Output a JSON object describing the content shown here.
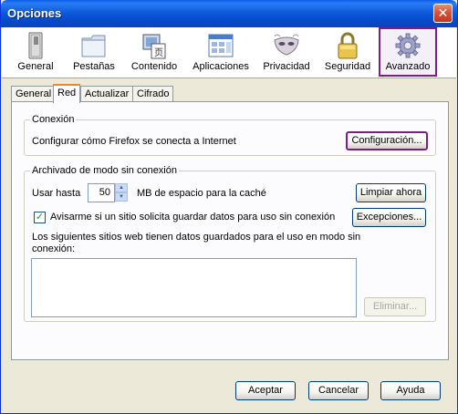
{
  "window": {
    "title": "Opciones",
    "close_glyph": "✕"
  },
  "toolbar": {
    "items": [
      {
        "label": "General",
        "icon": "general-icon"
      },
      {
        "label": "Pestañas",
        "icon": "tabs-icon"
      },
      {
        "label": "Contenido",
        "icon": "content-icon"
      },
      {
        "label": "Aplicaciones",
        "icon": "applications-icon"
      },
      {
        "label": "Privacidad",
        "icon": "privacy-mask-icon"
      },
      {
        "label": "Seguridad",
        "icon": "padlock-icon"
      },
      {
        "label": "Avanzado",
        "icon": "gear-icon",
        "selected": true
      }
    ]
  },
  "tabs": [
    {
      "label": "General"
    },
    {
      "label": "Red",
      "active": true
    },
    {
      "label": "Actualizar"
    },
    {
      "label": "Cifrado"
    }
  ],
  "connection": {
    "title": "Conexión",
    "description": "Configurar cómo Firefox se conecta a Internet",
    "settings_button": "Configuración..."
  },
  "offline": {
    "title": "Archivado de modo sin conexión",
    "use_up_to_label": "Usar hasta",
    "cache_value": "50",
    "cache_unit_label": "MB de espacio para la caché",
    "clear_button": "Limpiar ahora",
    "notify_checkbox_label": "Avisarme si un sitio solicita guardar datos para uso sin conexión",
    "notify_checked": true,
    "exceptions_button": "Excepciones...",
    "sites_label_line1": "Los siguientes sitios web tienen datos guardados para el uso en modo sin",
    "sites_label_line2": "conexión:",
    "remove_button": "Eliminar..."
  },
  "footer": {
    "accept_button": "Aceptar",
    "cancel_button": "Cancelar",
    "help_button": "Ayuda"
  },
  "colors": {
    "accent_highlight": "#7a1f8a",
    "titlebar": "#0a57d8"
  }
}
